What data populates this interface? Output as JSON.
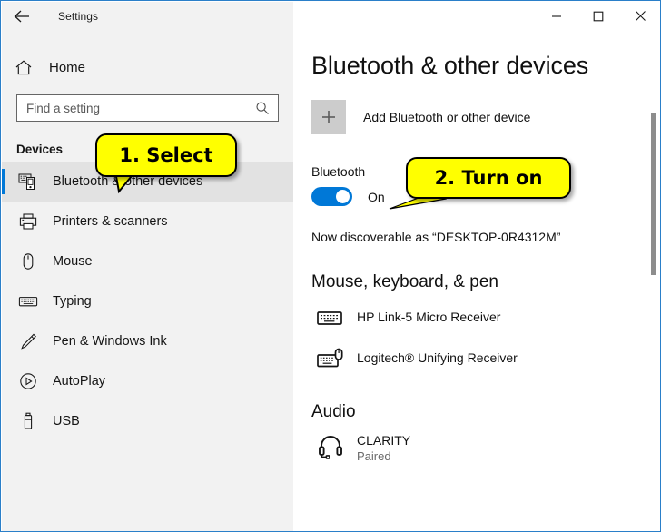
{
  "window": {
    "title": "Settings",
    "back_icon": "back-arrow-icon",
    "controls": {
      "minimize": "minimize-icon",
      "maximize": "maximize-icon",
      "close": "close-icon"
    }
  },
  "sidebar": {
    "home_label": "Home",
    "home_icon": "home-icon",
    "search": {
      "placeholder": "Find a setting",
      "value": "",
      "icon": "search-icon"
    },
    "section_title": "Devices",
    "items": [
      {
        "label": "Bluetooth & other devices",
        "icon": "bluetooth-devices-icon",
        "selected": true
      },
      {
        "label": "Printers & scanners",
        "icon": "printer-icon",
        "selected": false
      },
      {
        "label": "Mouse",
        "icon": "mouse-icon",
        "selected": false
      },
      {
        "label": "Typing",
        "icon": "keyboard-icon",
        "selected": false
      },
      {
        "label": "Pen & Windows Ink",
        "icon": "pen-icon",
        "selected": false
      },
      {
        "label": "AutoPlay",
        "icon": "autoplay-icon",
        "selected": false
      },
      {
        "label": "USB",
        "icon": "usb-icon",
        "selected": false
      }
    ]
  },
  "main": {
    "page_title": "Bluetooth & other devices",
    "add_device": {
      "label": "Add Bluetooth or other device",
      "icon": "plus-icon"
    },
    "bluetooth": {
      "label": "Bluetooth",
      "state": "On",
      "enabled": true,
      "discoverable_text": "Now discoverable as “DESKTOP-0R4312M”"
    },
    "groups": [
      {
        "title": "Mouse, keyboard, & pen",
        "devices": [
          {
            "name": "HP Link-5 Micro Receiver",
            "status": "",
            "icon": "keyboard-device-icon"
          },
          {
            "name": "Logitech® Unifying Receiver",
            "status": "",
            "icon": "keyboard-mouse-device-icon"
          }
        ]
      },
      {
        "title": "Audio",
        "devices": [
          {
            "name": "CLARITY",
            "status": "Paired",
            "icon": "headset-icon"
          }
        ]
      }
    ]
  },
  "callouts": [
    {
      "text": "1. Select"
    },
    {
      "text": "2. Turn on"
    }
  ],
  "colors": {
    "accent": "#0078d7",
    "callout_fill": "#ffff00",
    "sidebar_bg": "#f2f2f2",
    "window_border": "#2a7fc9"
  }
}
